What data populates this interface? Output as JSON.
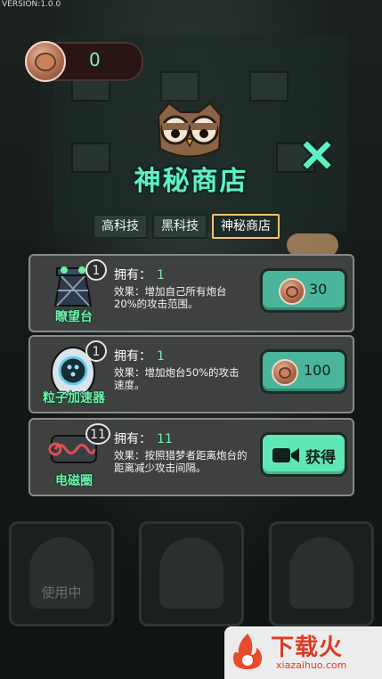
{
  "version": "VERSION:1.0.0",
  "coins": "0",
  "title": "神秘商店",
  "tabs": [
    {
      "label": "高科技",
      "active": false
    },
    {
      "label": "黑科技",
      "active": false
    },
    {
      "label": "神秘商店",
      "active": true
    }
  ],
  "owned_label": "拥有：",
  "items": [
    {
      "name": "瞭望台",
      "level": "1",
      "owned": "1",
      "effect": "效果：增加自己所有炮台20%的攻击范围。",
      "price": "30"
    },
    {
      "name": "粒子加速器",
      "level": "1",
      "owned": "1",
      "effect": "效果：增加炮台50%的攻击速度。",
      "price": "100"
    },
    {
      "name": "电磁圈",
      "level": "11",
      "owned": "11",
      "effect": "效果：按照猎梦者距离炮台的距离减少攻击间隔。",
      "action": "获得"
    }
  ],
  "background": {
    "using_label": "使用中"
  },
  "watermark": {
    "text": "下载火",
    "url": "xiazaihuo.com"
  },
  "colors": {
    "accent": "#5ff0c6",
    "name_green": "#6ef0a8",
    "button": "#4ab59a"
  }
}
